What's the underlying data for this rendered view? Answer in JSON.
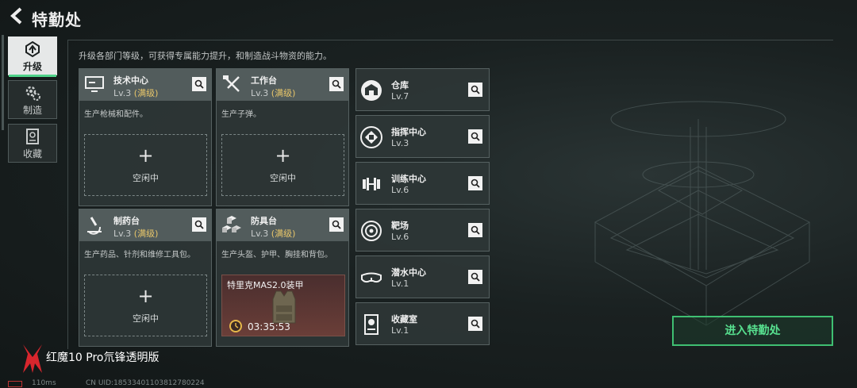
{
  "header": {
    "title": "特勤处"
  },
  "sidebar": {
    "items": [
      {
        "label": "升级",
        "icon": "upgrade-icon",
        "active": true
      },
      {
        "label": "制造",
        "icon": "gears-icon",
        "active": false
      },
      {
        "label": "收藏",
        "icon": "collection-icon",
        "active": false
      }
    ]
  },
  "description": "升级各部门等级，可获得专属能力提升，和制造战斗物资的能力。",
  "departments": [
    {
      "name": "技术中心",
      "level": "Lv.3",
      "max": "(满级)",
      "desc": "生产枪械和配件。",
      "slot_status": "空闲中",
      "icon": "monitor-icon"
    },
    {
      "name": "工作台",
      "level": "Lv.3",
      "max": "(满级)",
      "desc": "生产子弹。",
      "slot_status": "空闲中",
      "icon": "tools-icon"
    },
    {
      "name": "制药台",
      "level": "Lv.3",
      "max": "(满级)",
      "desc": "生产药品、针剂和维修工具包。",
      "slot_status": "空闲中",
      "icon": "microscope-icon"
    },
    {
      "name": "防具台",
      "level": "Lv.3",
      "max": "(满级)",
      "desc": "生产头盔、护甲、胸挂和背包。",
      "production": {
        "item": "特里克MAS2.0装甲",
        "time": "03:35:53"
      },
      "icon": "cubes-icon"
    }
  ],
  "side_departments": [
    {
      "name": "仓库",
      "level": "Lv.7",
      "icon": "warehouse-icon"
    },
    {
      "name": "指挥中心",
      "level": "Lv.3",
      "icon": "chip-icon"
    },
    {
      "name": "训练中心",
      "level": "Lv.6",
      "icon": "dumbbell-icon"
    },
    {
      "name": "靶场",
      "level": "Lv.6",
      "icon": "target-icon"
    },
    {
      "name": "潜水中心",
      "level": "Lv.1",
      "icon": "goggles-icon"
    },
    {
      "name": "收藏室",
      "level": "Lv.1",
      "icon": "showcase-icon"
    }
  ],
  "enter_button": "进入特勤处",
  "watermark": "红魔10 Pro氘锋透明版",
  "status": {
    "ping": "110ms",
    "uid": "CN UID:18533401103812780224"
  },
  "colors": {
    "accent": "#57e08f",
    "max_level": "#e8c66a"
  }
}
